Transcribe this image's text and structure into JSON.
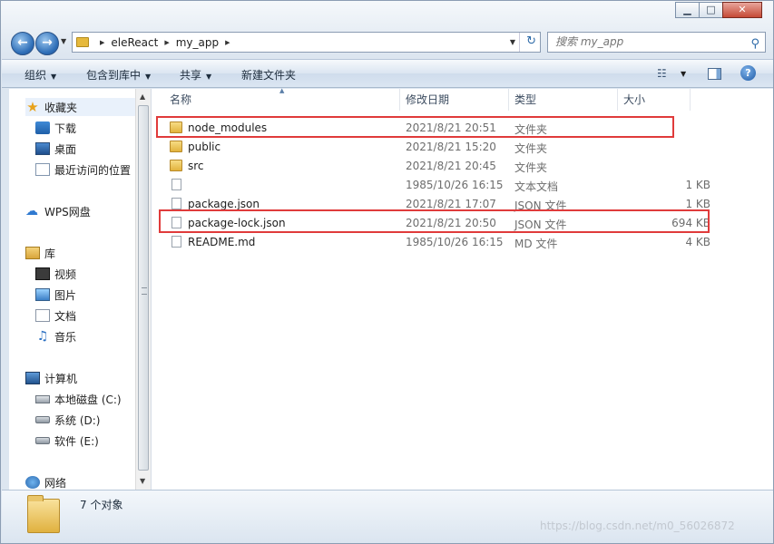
{
  "window": {
    "controls": {
      "minimize": "▁",
      "maximize": "□",
      "close": "✕"
    }
  },
  "address": {
    "crumbs": [
      "eleReact",
      "my_app"
    ],
    "refresh_icon": "refresh-icon"
  },
  "search": {
    "placeholder": "搜索 my_app"
  },
  "toolbar": {
    "organize": "组织",
    "include_in_library": "包含到库中",
    "share": "共享",
    "new_folder": "新建文件夹"
  },
  "nav": {
    "favorites": "收藏夹",
    "downloads": "下载",
    "desktop": "桌面",
    "recent": "最近访问的位置",
    "wps": "WPS网盘",
    "libraries": "库",
    "videos": "视频",
    "pictures": "图片",
    "documents": "文档",
    "music": "音乐",
    "computer": "计算机",
    "drive_c": "本地磁盘 (C:)",
    "drive_d": "系统 (D:)",
    "drive_e": "软件 (E:)",
    "network": "网络"
  },
  "columns": {
    "name": "名称",
    "date": "修改日期",
    "type": "类型",
    "size": "大小"
  },
  "files": [
    {
      "name": "node_modules",
      "date": "2021/8/21 20:51",
      "type": "文件夹",
      "size": "",
      "kind": "folder"
    },
    {
      "name": "public",
      "date": "2021/8/21 15:20",
      "type": "文件夹",
      "size": "",
      "kind": "folder"
    },
    {
      "name": "src",
      "date": "2021/8/21 20:45",
      "type": "文件夹",
      "size": "",
      "kind": "folder"
    },
    {
      "name": "",
      "date": "1985/10/26 16:15",
      "type": "文本文档",
      "size": "1 KB",
      "kind": "file"
    },
    {
      "name": "package.json",
      "date": "2021/8/21 17:07",
      "type": "JSON 文件",
      "size": "1 KB",
      "kind": "file"
    },
    {
      "name": "package-lock.json",
      "date": "2021/8/21 20:50",
      "type": "JSON 文件",
      "size": "694 KB",
      "kind": "file"
    },
    {
      "name": "README.md",
      "date": "1985/10/26 16:15",
      "type": "MD 文件",
      "size": "4 KB",
      "kind": "file"
    }
  ],
  "status": {
    "count": "7 个对象"
  },
  "watermark": "https://blog.csdn.net/m0_56026872",
  "colors": {
    "highlight_box": "#e03b3b",
    "accent": "#2f6fb8"
  }
}
